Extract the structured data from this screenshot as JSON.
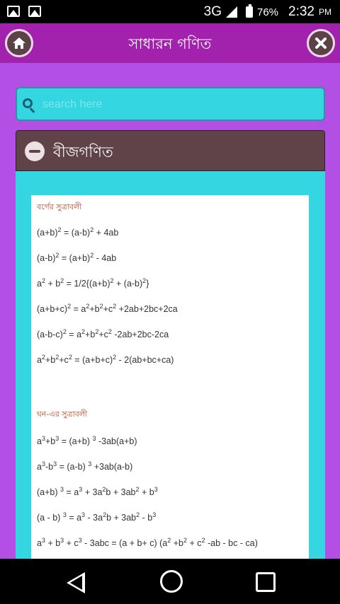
{
  "status_bar": {
    "network": "3G",
    "battery_percent": "76%",
    "time": "2:32",
    "ampm": "PM"
  },
  "app_bar": {
    "title": "সাধারন গণিত",
    "home_icon": "home-icon",
    "close_icon": "close-icon"
  },
  "search": {
    "placeholder": "search here",
    "value": ""
  },
  "panel": {
    "title": "বীজগণিত",
    "section1_title": "বর্গের সুত্রাবলী",
    "section2_title": "ঘন-এর সুত্রাবলী"
  },
  "colors": {
    "background": "#b44fe6",
    "appbar": "#a322ad",
    "accent_cyan": "#33d6e1",
    "panel_header": "#5f4349",
    "section_title": "#b5431a"
  }
}
